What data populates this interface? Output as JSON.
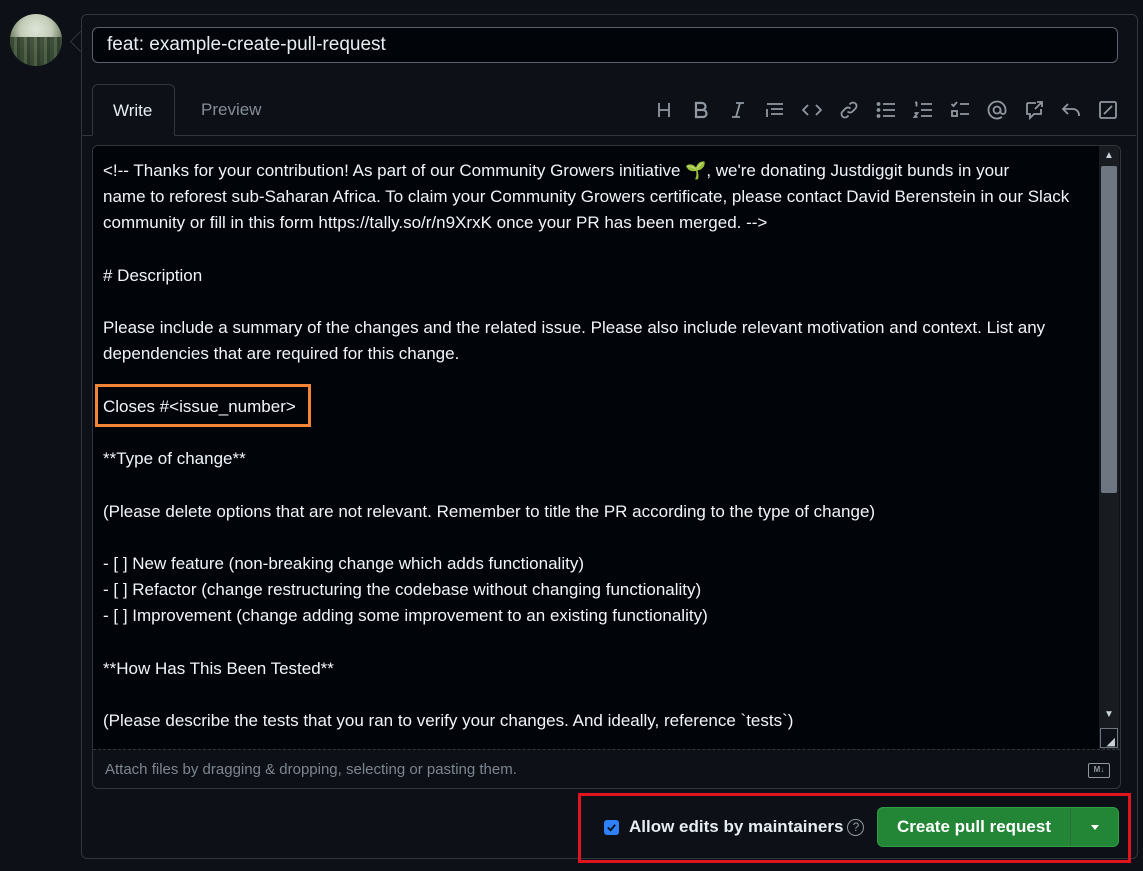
{
  "pr": {
    "title_value": "feat: example-create-pull-request"
  },
  "tabs": {
    "write": "Write",
    "preview": "Preview"
  },
  "toolbar": {
    "icons": [
      "heading-icon",
      "bold-icon",
      "italic-icon",
      "quote-icon",
      "code-icon",
      "link-icon",
      "unordered-list-icon",
      "ordered-list-icon",
      "task-list-icon",
      "mention-icon",
      "cross-reference-icon",
      "reply-icon",
      "fullscreen-icon"
    ]
  },
  "editor": {
    "lines": [
      "<!-- Thanks for your contribution! As part of our Community Growers initiative 🌱, we're donating Justdiggit bunds in your",
      "name to reforest sub-Saharan Africa. To claim your Community Growers certificate, please contact David Berenstein in our Slack",
      "community or fill in this form https://tally.so/r/n9XrxK once your PR has been merged. -->",
      "",
      "# Description",
      "",
      "Please include a summary of the changes and the related issue. Please also include relevant motivation and context. List any",
      "dependencies that are required for this change.",
      "",
      "Closes #<issue_number>",
      "",
      "**Type of change**",
      "",
      "(Please delete options that are not relevant. Remember to title the PR according to the type of change)",
      "",
      "- [ ] New feature (non-breaking change which adds functionality)",
      "- [ ] Refactor (change restructuring the codebase without changing functionality)",
      "- [ ] Improvement (change adding some improvement to an existing functionality)",
      "",
      "**How Has This Been Tested**",
      "",
      "(Please describe the tests that you ran to verify your changes. And ideally, reference `tests`)"
    ],
    "attach_hint": "Attach files by dragging & dropping, selecting or pasting them.",
    "markdown_badge": "M↓"
  },
  "footer": {
    "allow_edits_label": "Allow edits by maintainers",
    "allow_edits_checked": true,
    "help_glyph": "?",
    "create_button": "Create pull request"
  },
  "colors": {
    "background": "#0d1117",
    "accent_green": "#238636",
    "highlight_orange": "#f58536",
    "highlight_red": "#e0141e",
    "checkbox_blue": "#2f81f7"
  }
}
